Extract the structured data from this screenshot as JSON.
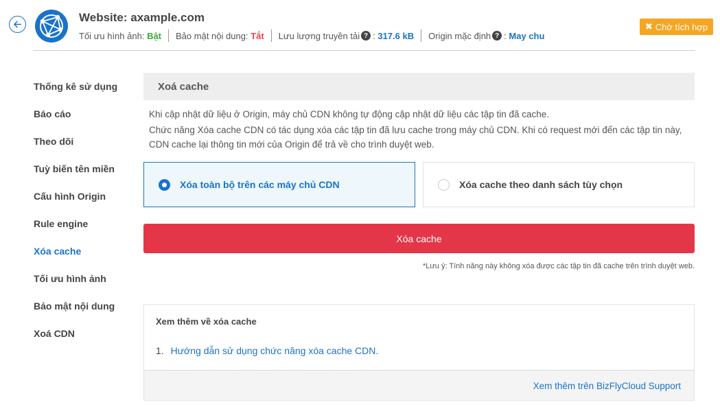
{
  "header": {
    "title": "Website: axample.com",
    "meta": {
      "image_opt_label": "Tối ưu hình ảnh:",
      "image_opt_value": "Bật",
      "content_sec_label": "Bảo mật nội dung:",
      "content_sec_value": "Tắt",
      "traffic_label": "Lưu lượng truyền tải",
      "traffic_value": "317.6 kB",
      "origin_label": "Origin mặc định",
      "origin_value": "May chu"
    },
    "badge_icon": "✖",
    "badge_label": "Chờ tích hợp"
  },
  "sidebar": {
    "items": [
      {
        "label": "Thống kê sử dụng"
      },
      {
        "label": "Báo cáo"
      },
      {
        "label": "Theo dõi"
      },
      {
        "label": "Tuỳ biến tên miền"
      },
      {
        "label": "Cấu hình Origin"
      },
      {
        "label": "Rule engine"
      },
      {
        "label": "Xóa cache",
        "active": true
      },
      {
        "label": "Tối ưu hình ảnh"
      },
      {
        "label": "Bảo mật nội dung"
      },
      {
        "label": "Xoá CDN"
      }
    ]
  },
  "main": {
    "section_title": "Xoá cache",
    "desc1": "Khi cập nhật dữ liệu ở Origin, máy chủ CDN không tự động cập nhật dữ liệu các tập tin đã cache.",
    "desc2": "Chức năng Xóa cache CDN có tác dụng xóa các tập tin đã lưu cache trong máy chủ CDN. Khi có request mới đến các tập tin này, CDN cache lại thông tin mới của Origin để trả về cho trình duyệt web.",
    "option_all": "Xóa toàn bộ trên các máy chủ CDN",
    "option_list": "Xóa cache theo danh sách tùy chọn",
    "selected_option": "all",
    "clear_button": "Xóa cache",
    "note": "*Lưu ý: Tính năng này không xóa được các tập tin đã cache trên trình duyệt web."
  },
  "more": {
    "title": "Xem thêm về xóa cache",
    "items": [
      {
        "num": "1.",
        "label": "Hướng dẫn sử dụng chức năng xóa cache CDN."
      }
    ],
    "footer_link": "Xem thêm trên BizFlyCloud Support"
  },
  "colors": {
    "accent": "#1a73c9",
    "danger": "#e43649",
    "warning": "#f5a623",
    "on": "#3aaa35",
    "off": "#e8474c"
  }
}
